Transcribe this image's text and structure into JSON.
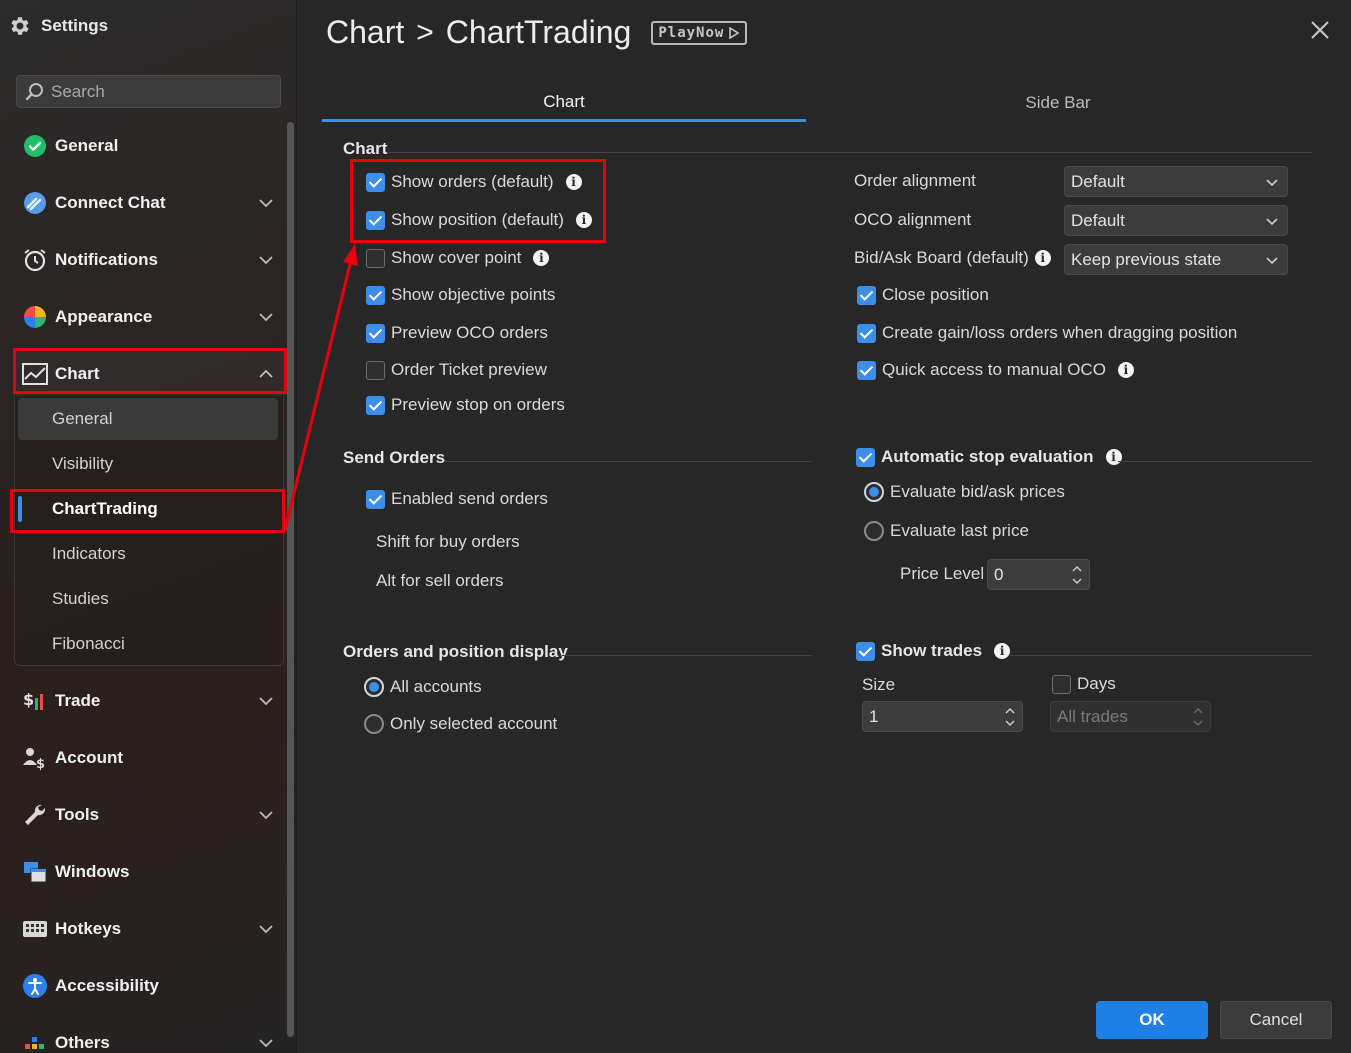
{
  "sidebar": {
    "title": "Settings",
    "search_placeholder": "Search",
    "items": [
      {
        "label": "General",
        "icon": "check-circle-icon"
      },
      {
        "label": "Connect Chat",
        "icon": "chat-icon"
      },
      {
        "label": "Notifications",
        "icon": "alarm-clock-icon"
      },
      {
        "label": "Appearance",
        "icon": "color-wheel-icon"
      },
      {
        "label": "Chart",
        "icon": "chart-icon"
      },
      {
        "label": "Trade",
        "icon": "trade-icon"
      },
      {
        "label": "Account",
        "icon": "account-icon"
      },
      {
        "label": "Tools",
        "icon": "wrench-icon"
      },
      {
        "label": "Windows",
        "icon": "windows-icon"
      },
      {
        "label": "Hotkeys",
        "icon": "keyboard-icon"
      },
      {
        "label": "Accessibility",
        "icon": "accessibility-icon"
      },
      {
        "label": "Others",
        "icon": "others-icon"
      }
    ],
    "chart_sub": [
      "General",
      "Visibility",
      "ChartTrading",
      "Indicators",
      "Studies",
      "Fibonacci"
    ]
  },
  "header": {
    "crumb_parent": "Chart",
    "crumb_sep": ">",
    "crumb_current": "ChartTrading",
    "badge": "PlayNow"
  },
  "tabs": [
    "Chart",
    "Side Bar"
  ],
  "chart_section": {
    "title": "Chart",
    "options": [
      {
        "label": "Show orders (default)",
        "checked": true
      },
      {
        "label": "Show position (default)",
        "checked": true
      },
      {
        "label": "Show cover point",
        "checked": false
      },
      {
        "label": "Show objective points",
        "checked": true
      },
      {
        "label": "Preview OCO orders",
        "checked": true
      },
      {
        "label": "Order Ticket preview",
        "checked": false
      },
      {
        "label": "Preview stop on orders",
        "checked": true
      }
    ],
    "order_alignment": {
      "label": "Order alignment",
      "value": "Default"
    },
    "oco_alignment": {
      "label": "OCO alignment",
      "value": "Default"
    },
    "bid_ask_board": {
      "label": "Bid/Ask Board (default)",
      "value": "Keep previous state"
    },
    "right_options": [
      {
        "label": "Close position",
        "checked": true
      },
      {
        "label": "Create gain/loss orders when dragging position",
        "checked": true
      },
      {
        "label": "Quick access to manual OCO",
        "checked": true
      }
    ]
  },
  "send_orders": {
    "title": "Send Orders",
    "enabled": "Enabled send orders",
    "shift": "Shift for buy orders",
    "alt": "Alt for sell orders"
  },
  "auto_stop": {
    "title": "Automatic stop evaluation",
    "opt1": "Evaluate bid/ask prices",
    "opt2": "Evaluate last price",
    "price_level_label": "Price Level",
    "price_level_value": "0"
  },
  "orders_display": {
    "title": "Orders and position display",
    "opt1": "All accounts",
    "opt2": "Only selected account"
  },
  "show_trades": {
    "title": "Show trades",
    "size_label": "Size",
    "size_value": "1",
    "days_label": "Days",
    "days_placeholder": "All trades"
  },
  "footer": {
    "ok": "OK",
    "cancel": "Cancel"
  },
  "colors": {
    "accent": "#3c8ee8",
    "highlight_red": "#e8000e",
    "ok_button": "#1e7fe6"
  }
}
